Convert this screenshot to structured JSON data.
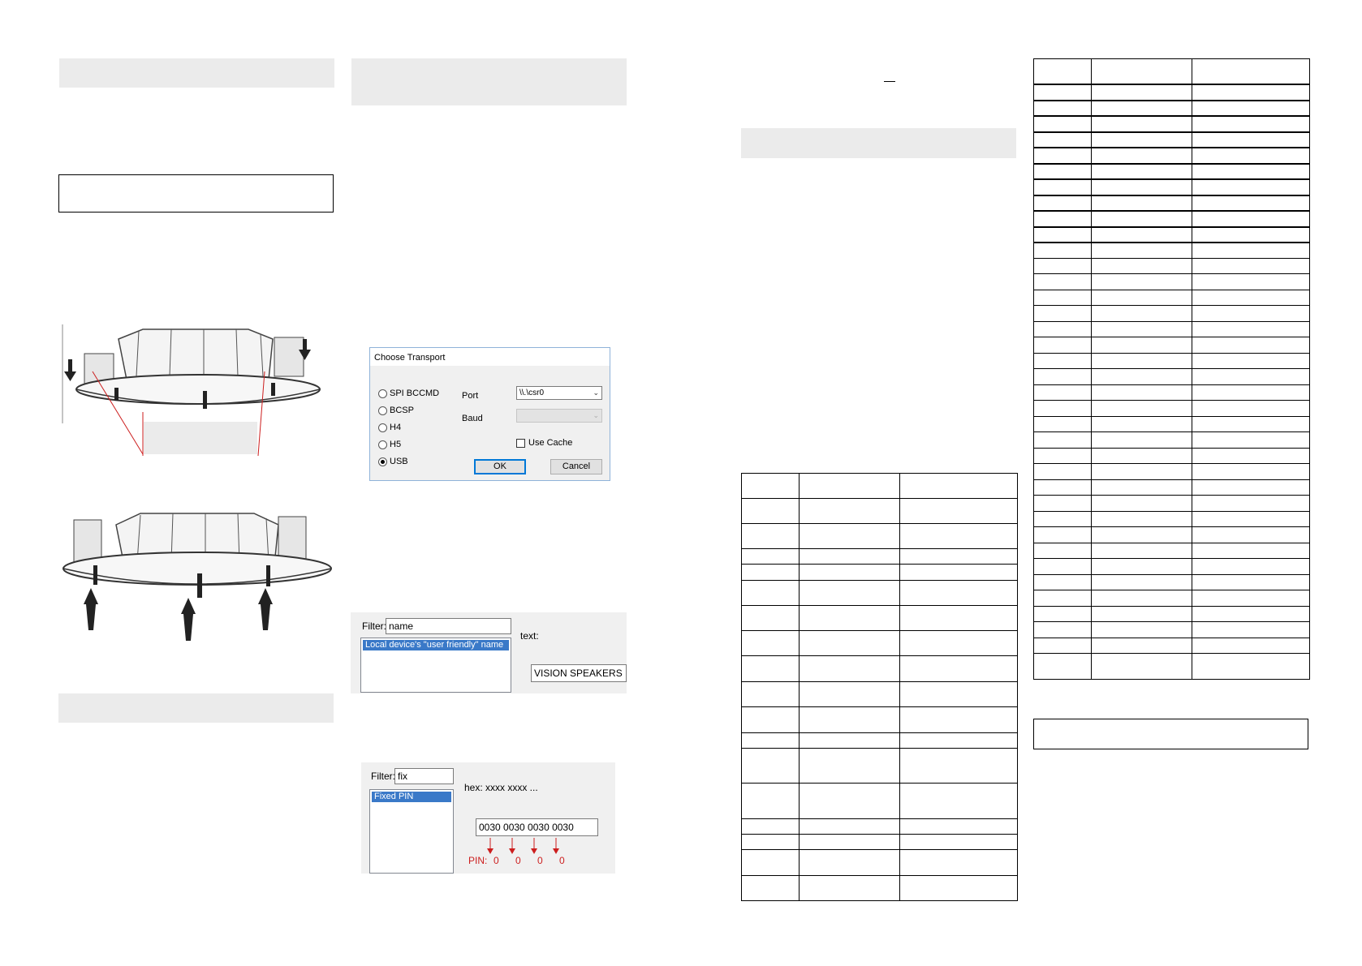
{
  "dialog": {
    "title": "Choose Transport",
    "radios": [
      "SPI BCCMD",
      "BCSP",
      "H4",
      "H5",
      "USB"
    ],
    "selected_radio": "USB",
    "port_label": "Port",
    "port_value": "\\\\.\\csr0",
    "baud_label": "Baud",
    "baud_value": "",
    "use_cache_label": "Use Cache",
    "ok_label": "OK",
    "cancel_label": "Cancel"
  },
  "name_panel": {
    "filter_label": "Filter:",
    "filter_value": "name",
    "list_item": "Local device's \"user friendly\" name",
    "text_label": "text:",
    "text_value": "VISION SPEAKERS"
  },
  "pin_panel": {
    "filter_label": "Filter:",
    "filter_value": "fix",
    "list_item": "Fixed PIN",
    "hex_label": "hex: xxxx xxxx ...",
    "hex_value": "0030 0030 0030 0030",
    "pin_label": "PIN:",
    "pin_digits": [
      "0",
      "0",
      "0",
      "0"
    ]
  },
  "colors": {
    "grey_bar": "#ebebeb",
    "selection_blue": "#3a79c8",
    "annotation_red": "#cc1e1e",
    "dialog_accent": "#0078d7"
  },
  "icons": {
    "down_arrows": "arrow-down-icon",
    "up_arrows": "arrow-up-icon"
  }
}
